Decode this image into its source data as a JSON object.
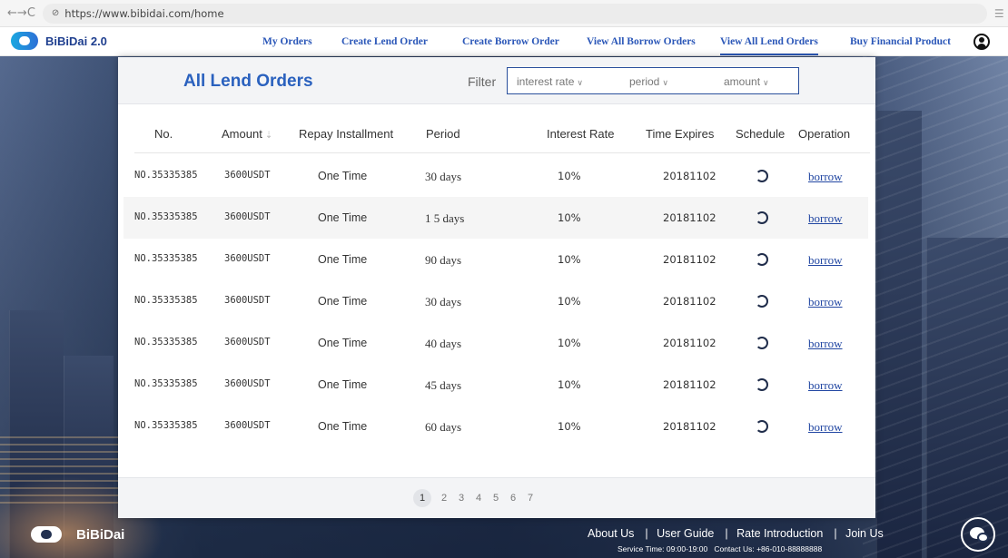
{
  "browser": {
    "url": "https://www.bibidai.com/home",
    "back_icon": "back-arrow-icon",
    "forward_icon": "forward-arrow-icon",
    "reload_icon": "reload-icon"
  },
  "nav": {
    "brand": "BiBiDai 2.0",
    "links": [
      "My Orders",
      "Create Lend Order",
      "Create Borrow  Order",
      "View All  Borrow Orders",
      "View All Lend Orders",
      "Buy Financial Product"
    ],
    "active": "View All Lend Orders",
    "accent": "#2b57b8"
  },
  "panel": {
    "title": "All Lend Orders",
    "filter_label": "Filter",
    "filters": [
      "interest rate",
      "period",
      "amount"
    ]
  },
  "table": {
    "headers": [
      "No.",
      "Amount",
      "Repay Installment",
      "Period",
      "Interest Rate",
      "Time Expires",
      "Schedule",
      "Operation"
    ],
    "rows": [
      {
        "no": "NO.35335385",
        "amount": "3600USDT",
        "repay": "One Time",
        "period": "30 days",
        "rate": "10%",
        "expires": "20181102",
        "operation": "borrow"
      },
      {
        "no": "NO.35335385",
        "amount": "3600USDT",
        "repay": "One Time",
        "period": "1 5 days",
        "rate": "10%",
        "expires": "20181102",
        "operation": "borrow"
      },
      {
        "no": "NO.35335385",
        "amount": "3600USDT",
        "repay": "One Time",
        "period": "90 days",
        "rate": "10%",
        "expires": "20181102",
        "operation": "borrow"
      },
      {
        "no": "NO.35335385",
        "amount": "3600USDT",
        "repay": "One Time",
        "period": "30 days",
        "rate": "10%",
        "expires": "20181102",
        "operation": "borrow"
      },
      {
        "no": "NO.35335385",
        "amount": "3600USDT",
        "repay": "One Time",
        "period": "40 days",
        "rate": "10%",
        "expires": "20181102",
        "operation": "borrow"
      },
      {
        "no": "NO.35335385",
        "amount": "3600USDT",
        "repay": "One Time",
        "period": "45 days",
        "rate": "10%",
        "expires": "20181102",
        "operation": "borrow"
      },
      {
        "no": "NO.35335385",
        "amount": "3600USDT",
        "repay": "One Time",
        "period": "60 days",
        "rate": "10%",
        "expires": "20181102",
        "operation": "borrow"
      }
    ]
  },
  "pagination": {
    "pages": [
      "1",
      "2",
      "3",
      "4",
      "5",
      "6",
      "7"
    ],
    "current": "1"
  },
  "footer": {
    "brand": "BiBiDai",
    "links": [
      "About Us",
      "User Guide",
      "Rate Introduction",
      "Join Us"
    ],
    "service_time": "Service Time: 09:00-19:00",
    "contact": "Contact Us: +86-010-88888888"
  }
}
